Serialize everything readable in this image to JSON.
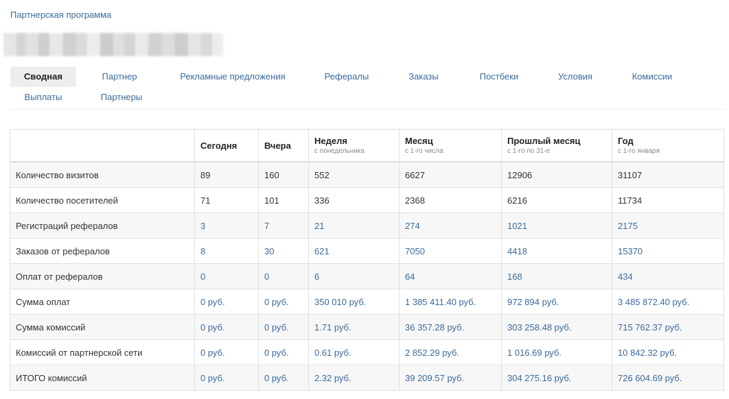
{
  "breadcrumb": "Партнерская программа",
  "tabs": [
    {
      "label": "Сводная",
      "active": true
    },
    {
      "label": "Партнер"
    },
    {
      "label": "Рекламные предложения"
    },
    {
      "label": "Рефералы"
    },
    {
      "label": "Заказы"
    },
    {
      "label": "Постбеки"
    },
    {
      "label": "Условия"
    },
    {
      "label": "Комиссии"
    },
    {
      "label": "Выплаты"
    },
    {
      "label": "Партнеры"
    }
  ],
  "table": {
    "columns": [
      {
        "title": "",
        "sub": ""
      },
      {
        "title": "Сегодня",
        "sub": ""
      },
      {
        "title": "Вчера",
        "sub": ""
      },
      {
        "title": "Неделя",
        "sub": "с понедельника"
      },
      {
        "title": "Месяц",
        "sub": "с 1-го числа"
      },
      {
        "title": "Прошлый месяц",
        "sub": "с 1-го по 31-е"
      },
      {
        "title": "Год",
        "sub": "с 1-го января"
      }
    ],
    "rows": [
      {
        "label": "Количество визитов",
        "values": [
          "89",
          "160",
          "552",
          "6627",
          "12906",
          "31107"
        ],
        "link": false
      },
      {
        "label": "Количество посетителей",
        "values": [
          "71",
          "101",
          "336",
          "2368",
          "6216",
          "11734"
        ],
        "link": false
      },
      {
        "label": "Регистраций рефералов",
        "values": [
          "3",
          "7",
          "21",
          "274",
          "1021",
          "2175"
        ],
        "link": true
      },
      {
        "label": "Заказов от рефералов",
        "values": [
          "8",
          "30",
          "621",
          "7050",
          "4418",
          "15370"
        ],
        "link": true
      },
      {
        "label": "Оплат от рефералов",
        "values": [
          "0",
          "0",
          "6",
          "64",
          "168",
          "434"
        ],
        "link": true
      },
      {
        "label": "Сумма оплат",
        "values": [
          "0 руб.",
          "0 руб.",
          "350 010 руб.",
          "1 385 411.40 руб.",
          "972 894 руб.",
          "3 485 872.40 руб."
        ],
        "link": true
      },
      {
        "label": "Сумма комиссий",
        "values": [
          "0 руб.",
          "0 руб.",
          "1.71 руб.",
          "36 357.28 руб.",
          "303 258.48 руб.",
          "715 762.37 руб."
        ],
        "link": true
      },
      {
        "label": "Комиссий от партнерской сети",
        "values": [
          "0 руб.",
          "0 руб.",
          "0.61 руб.",
          "2 852.29 руб.",
          "1 016.69 руб.",
          "10 842.32 руб."
        ],
        "link": true
      },
      {
        "label": "ИТОГО комиссий",
        "values": [
          "0 руб.",
          "0 руб.",
          "2.32 руб.",
          "39 209.57 руб.",
          "304 275.16 руб.",
          "726 604.69 руб."
        ],
        "link": true
      }
    ]
  }
}
